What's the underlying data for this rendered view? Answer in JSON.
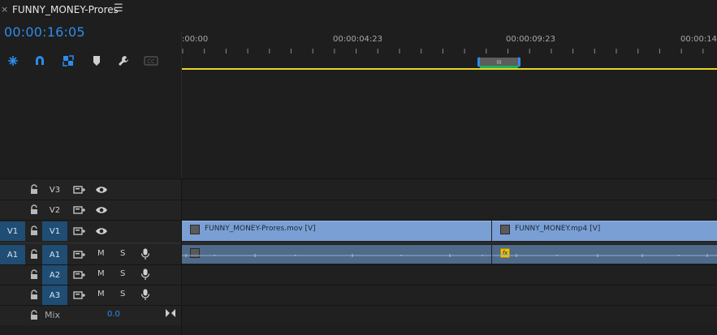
{
  "tab": {
    "title": "FUNNY_MONEY-Prores",
    "close": "×",
    "menu": "☰"
  },
  "timecode": "00:00:16:05",
  "toolbar": [
    "snap-icon",
    "linked-selection-icon",
    "add-marker-icon",
    "marker-icon",
    "wrench-icon",
    "captions-icon"
  ],
  "ruler": {
    "labels": [
      ":00:00",
      "00:00:04:23",
      "00:00:09:23",
      "00:00:14:"
    ]
  },
  "tracks": {
    "v3": {
      "target": "V3"
    },
    "v2": {
      "target": "V2"
    },
    "v1": {
      "source": "V1",
      "target": "V1"
    },
    "a1": {
      "source": "A1",
      "target": "A1",
      "mute": "M",
      "solo": "S"
    },
    "a2": {
      "target": "A2",
      "mute": "M",
      "solo": "S"
    },
    "a3": {
      "target": "A3",
      "mute": "M",
      "solo": "S"
    }
  },
  "mix": {
    "label": "Mix",
    "value": "0.0"
  },
  "clips": {
    "v1_clip1": "FUNNY_MONEY-Prores.mov [V]",
    "v1_clip2": "FUNNY_MONEY.mp4 [V]",
    "fx": "fx"
  },
  "colors": {
    "accent": "#2d8ceb",
    "track_target": "#1f4d74",
    "video_clip": "#7a9fd4",
    "audio_clip": "#4f6a8a",
    "work_area": "#e8d524"
  }
}
